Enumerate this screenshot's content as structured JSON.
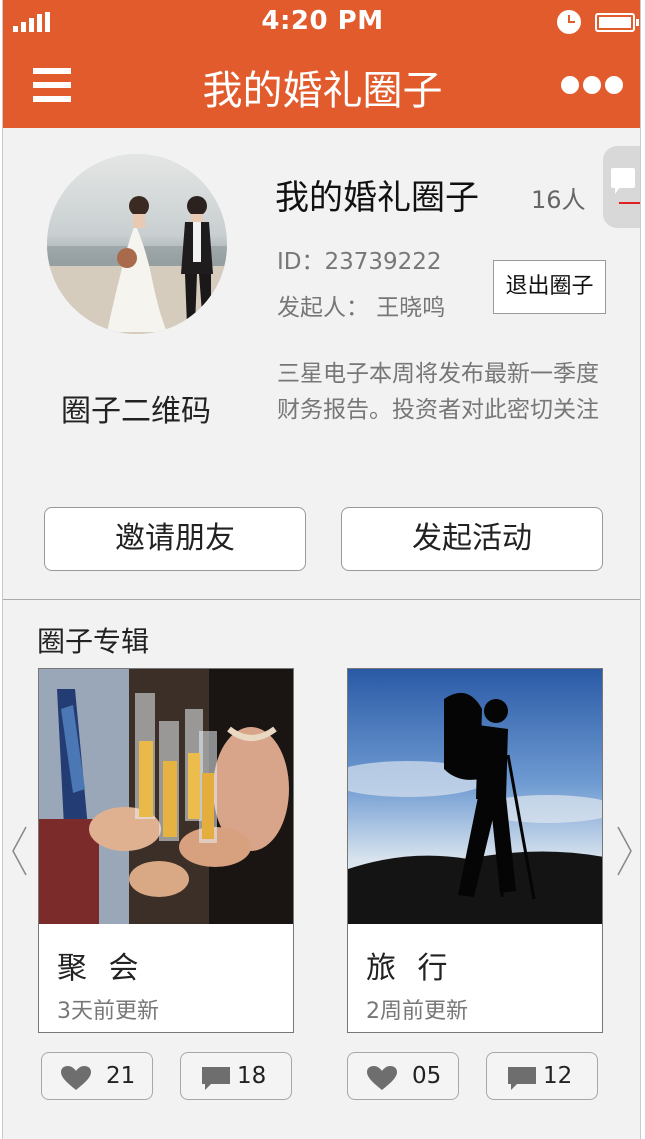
{
  "status_bar": {
    "time": "4:20 PM"
  },
  "header": {
    "title": "我的婚礼圈子"
  },
  "group": {
    "name": "我的婚礼圈子",
    "members": "16人",
    "id": "ID：23739222",
    "founder": "发起人： 王晓鸣",
    "quit_label": "退出圈子",
    "qr_label": "圈子二维码",
    "description": "三星电子本周将发布最新一季度财务报告。投资者对此密切关注"
  },
  "actions": {
    "invite_label": "邀请朋友",
    "start_activity_label": "发起活动"
  },
  "albums": {
    "title": "圈子专辑",
    "items": [
      {
        "name": "聚 会",
        "updated": "3天前更新",
        "likes": "21",
        "comments": "18"
      },
      {
        "name": "旅 行",
        "updated": "2周前更新",
        "likes": "05",
        "comments": "12"
      }
    ]
  },
  "colors": {
    "brand": "#e25b2c",
    "background": "#f2f2f2"
  }
}
